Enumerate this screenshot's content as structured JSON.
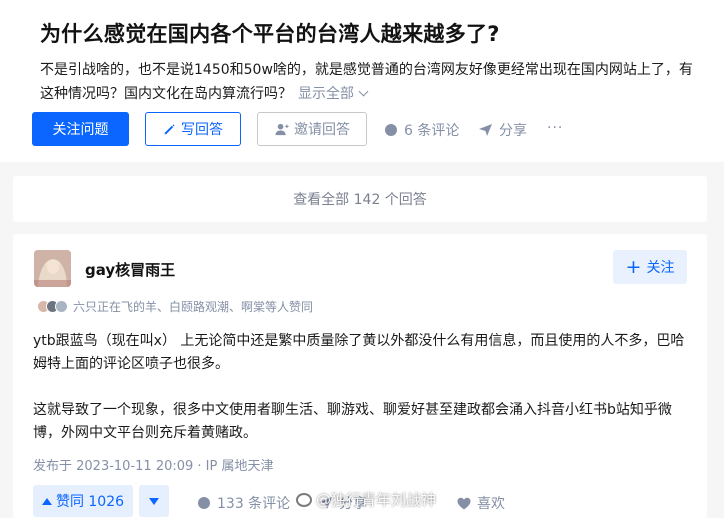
{
  "question": {
    "title": "为什么感觉在国内各个平台的台湾人越来越多了?",
    "description": "不是引战啥的，也不是说1450和50w啥的，就是感觉普通的台湾网友好像更经常出现在国内网站上了，有这种情况吗？国内文化在岛内算流行吗？",
    "show_all": "显示全部",
    "follow_label": "关注问题",
    "write_label": "写回答",
    "invite_label": "邀请回答",
    "comments_label": "6 条评论",
    "share_label": "分享",
    "more_label": "···"
  },
  "view_all": "查看全部 142 个回答",
  "answer": {
    "author": "gay核冒雨王",
    "follow_label": "关注",
    "voters": "六只正在飞的羊、白颐路观潮、啊棠等人赞同",
    "para1": "ytb跟蓝鸟（现在叫x） 上无论简中还是繁中质量除了黄以外都没什么有用信息，而且使用的人不多，巴哈姆特上面的评论区喷子也很多。",
    "para2": "这就导致了一个现象，很多中文使用者聊生活、聊游戏、聊爱好甚至建政都会涌入抖音小红书b站知乎微博，外网中文平台则充斥着黄赌政。",
    "published": "发布于 2023-10-11 20:09 · IP 属地天津",
    "vote_label": "赞同 1026",
    "comments_label": "133 条评论",
    "share_label": "分享",
    "like_label": "喜欢"
  },
  "watermark": "@独行青年刘战神",
  "colors": {
    "accent": "#0b66ff",
    "accent_light": "#e5effe",
    "muted": "#8590a6",
    "page_bg": "#f6f6f6"
  }
}
